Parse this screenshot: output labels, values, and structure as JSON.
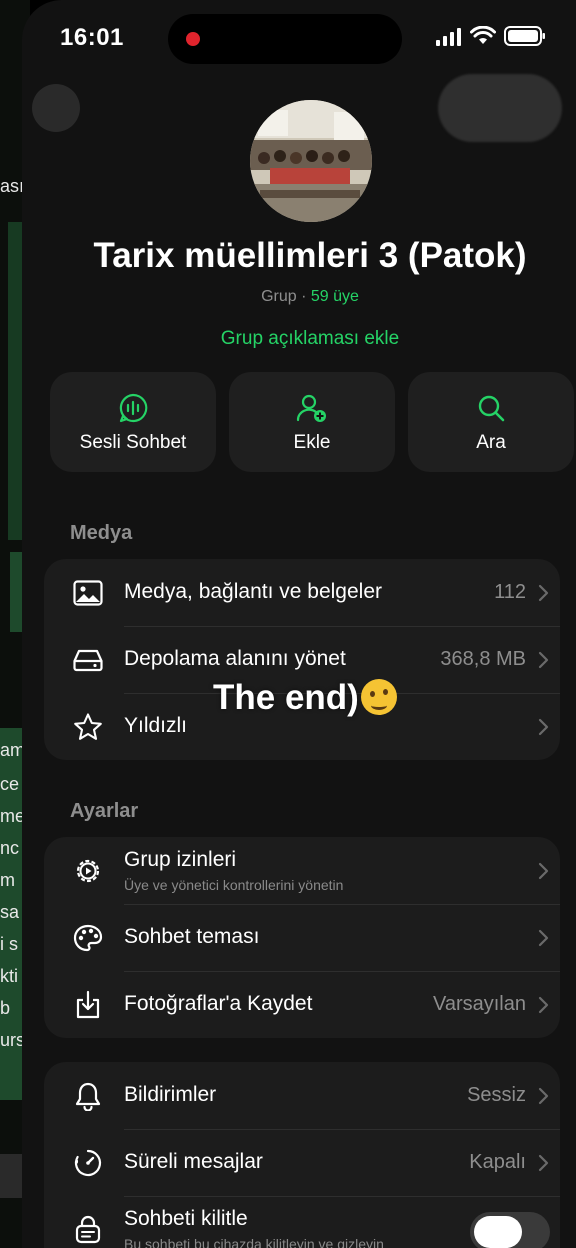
{
  "status_bar": {
    "time": "16:01"
  },
  "underlay": {
    "fragments": [
      "ası",
      "am",
      "ce",
      "me",
      "nc",
      "m",
      "sa",
      "i s",
      "kti",
      " b",
      "urs"
    ]
  },
  "group": {
    "name": "Tarix müellimleri 3 (Patok)",
    "type_label": "Grup",
    "separator": "·",
    "members_label": "59 üye",
    "add_description": "Grup açıklaması ekle"
  },
  "actions": [
    {
      "label": "Sesli Sohbet",
      "icon": "voice-chat-icon"
    },
    {
      "label": "Ekle",
      "icon": "add-person-icon"
    },
    {
      "label": "Ara",
      "icon": "search-icon"
    }
  ],
  "media_section": {
    "title": "Medya",
    "rows": [
      {
        "label": "Medya, bağlantı ve belgeler",
        "value": "112",
        "icon": "photo-icon"
      },
      {
        "label": "Depolama alanını yönet",
        "value": "368,8 MB",
        "icon": "storage-icon"
      },
      {
        "label": "Yıldızlı",
        "value": "",
        "icon": "star-icon"
      }
    ]
  },
  "settings_section": {
    "title": "Ayarlar",
    "rows": [
      {
        "label": "Grup izinleri",
        "sub": "Üye ve yönetici kontrollerini yönetin",
        "value": "",
        "icon": "gear-icon"
      },
      {
        "label": "Sohbet teması",
        "value": "",
        "icon": "palette-icon"
      },
      {
        "label": "Fotoğraflar'a Kaydet",
        "value": "Varsayılan",
        "icon": "save-download-icon"
      }
    ]
  },
  "notify_section": {
    "rows": [
      {
        "label": "Bildirimler",
        "value": "Sessiz",
        "icon": "bell-icon"
      },
      {
        "label": "Süreli mesajlar",
        "value": "Kapalı",
        "icon": "timer-icon"
      },
      {
        "label": "Sohbeti kilitle",
        "sub": "Bu sohbeti bu cihazda kilitleyin ve gizleyin",
        "toggle": false,
        "icon": "lock-chat-icon"
      }
    ]
  },
  "overlay": {
    "text": "The end)"
  },
  "colors": {
    "accent": "#25d366",
    "background": "#121212",
    "card": "#1c1c1c",
    "secondary_text": "#8e8e8e"
  }
}
